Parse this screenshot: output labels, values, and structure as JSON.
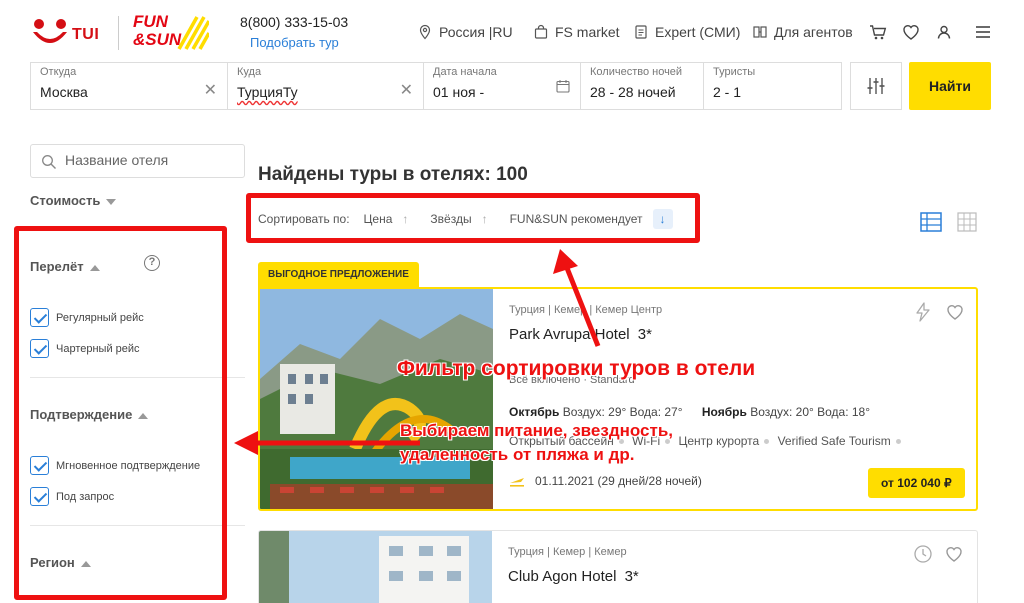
{
  "header": {
    "logo_tui": "TUI",
    "logo_funsun_line1": "FUN",
    "logo_funsun_line2": "&SUN",
    "phone": "8(800) 333-15-03",
    "pick_tour": "Подобрать тур",
    "nav": [
      {
        "label": "Россия |RU",
        "icon": "location-pin-icon"
      },
      {
        "label": "FS market",
        "icon": "shopping-bag-icon"
      },
      {
        "label": "Expert (СМИ)",
        "icon": "document-icon"
      },
      {
        "label": "Для агентов",
        "icon": "handshake-icon"
      }
    ],
    "icons": [
      "cart-icon",
      "heart-icon",
      "user-icon",
      "menu-icon"
    ]
  },
  "search": {
    "from": {
      "label": "Откуда",
      "value": "Москва"
    },
    "to": {
      "label": "Куда",
      "value": "ТурцияТу"
    },
    "date": {
      "label": "Дата начала",
      "value": "01 ноя -"
    },
    "nights": {
      "label": "Количество ночей",
      "value": "28 - 28 ночей"
    },
    "tourists": {
      "label": "Туристы",
      "value": "2 - 1"
    },
    "find_label": "Найти"
  },
  "sidebar": {
    "hotel_placeholder": "Название отеля",
    "cost_label": "Стоимость",
    "flight_title": "Перелёт",
    "flight_options": [
      "Регулярный рейс",
      "Чартерный рейс"
    ],
    "confirm_title": "Подтверждение",
    "confirm_options": [
      "Мгновенное подтверждение",
      "Под запрос"
    ],
    "region_title": "Регион"
  },
  "results": {
    "title": "Найдены туры в отелях: 100",
    "sort_label": "Сортировать по:",
    "sort_options": [
      "Цена",
      "Звёзды",
      "FUN&SUN рекомендует"
    ]
  },
  "cards": [
    {
      "badge": "ВЫГОДНОЕ ПРЕДЛОЖЕНИЕ",
      "breadcrumb": "Турция | Кемер | Кемер Центр",
      "name": "Park Avrupa Hotel",
      "stars": "3*",
      "amenities": "Всё включено · Standard",
      "weather_oct_label": "Октябрь",
      "weather_oct": "Воздух: 29° Вода: 27°",
      "weather_nov_label": "Ноябрь",
      "weather_nov": "Воздух: 20° Вода: 18°",
      "features": [
        "Открытый бассейн",
        "Wi-Fi",
        "Центр курорта",
        "Verified Safe Tourism"
      ],
      "date": "01.11.2021 (29 дней/28 ночей)",
      "price": "от 102 040 ₽"
    },
    {
      "breadcrumb": "Турция | Кемер | Кемер",
      "name": "Club Agon Hotel",
      "stars": "3*"
    }
  ],
  "annotations": {
    "sort_caption": "Фильтр сортировки туров в отели",
    "filter_caption_line1": "Выбираем питание, звездность,",
    "filter_caption_line2": "удаленность от пляжа и др."
  },
  "colors": {
    "accent_yellow": "#ffdd00",
    "link_blue": "#2a7fd8",
    "annotation_red": "#ee1111",
    "tui_red": "#d40e14"
  }
}
